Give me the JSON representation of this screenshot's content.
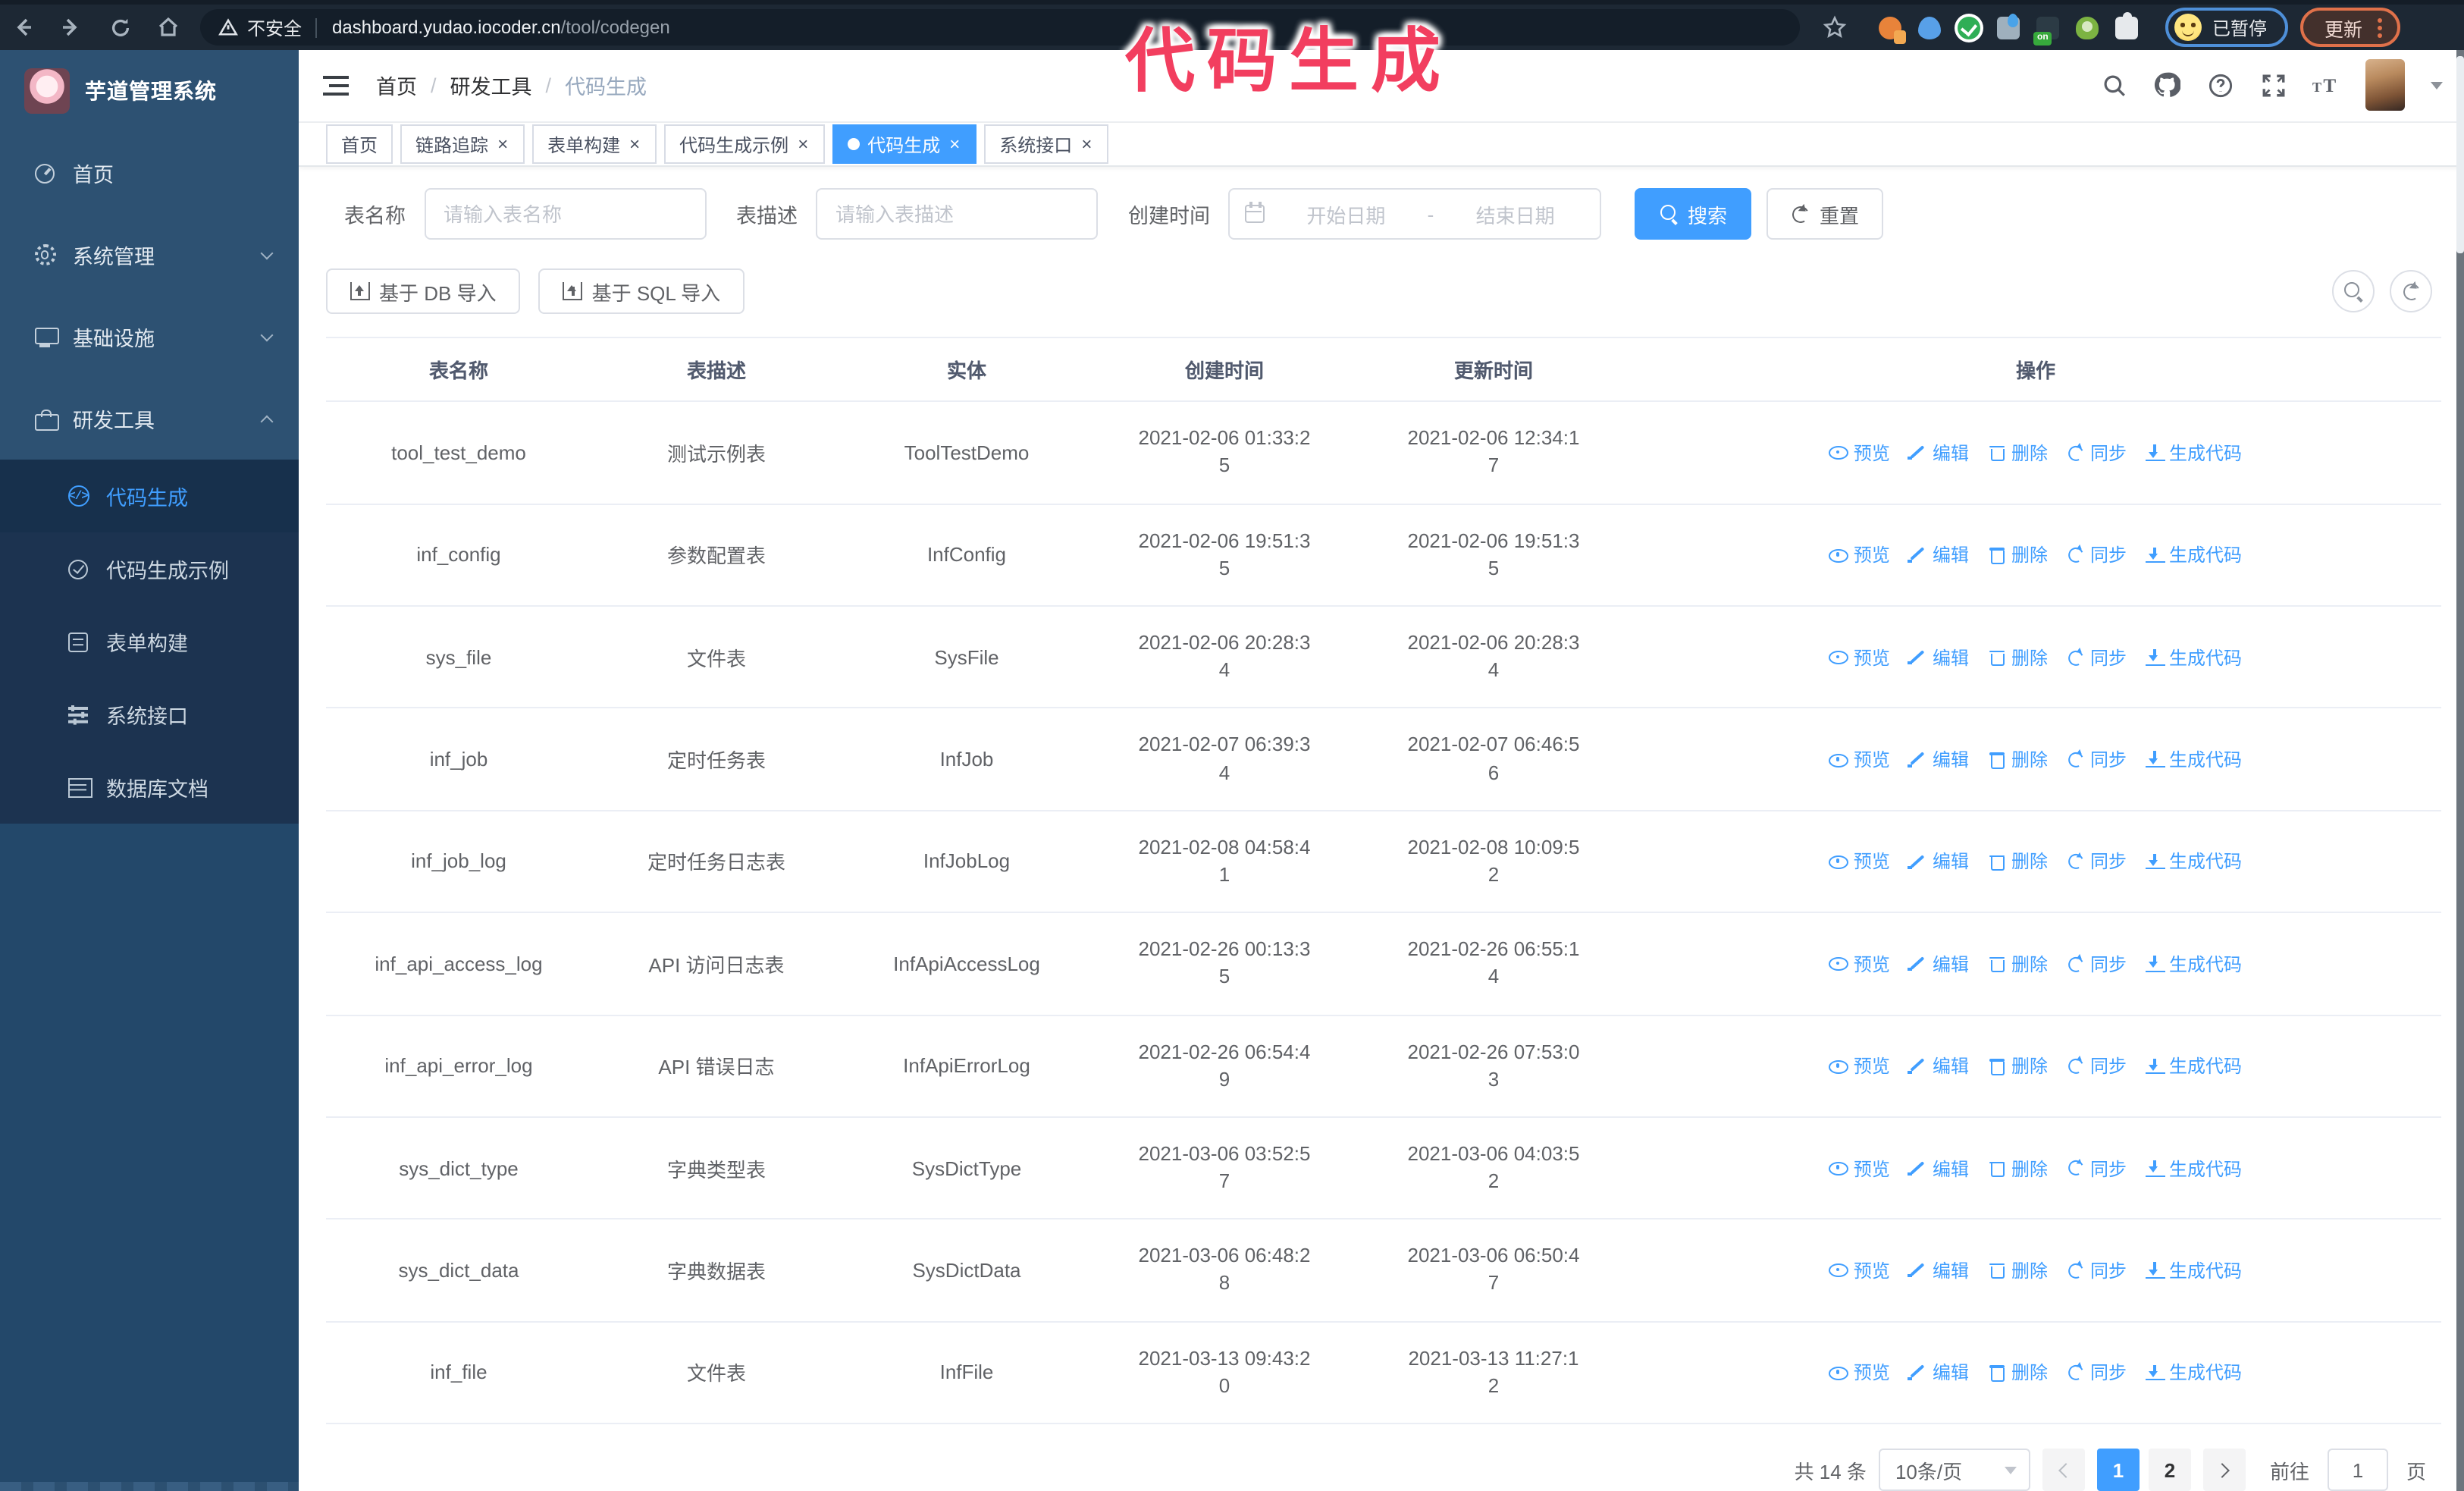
{
  "colors": {
    "primary": "#409EFF",
    "annotation": "#F23E5F",
    "sidebar_bg": "#23486A",
    "sidebar_menu_bg": "#2D5172",
    "sidebar_submenu_bg": "#1C3350",
    "chrome_bg": "#1D2834",
    "tag_active_bg": "#409EFF"
  },
  "browser": {
    "nav_icons": [
      "back-icon",
      "forward-icon",
      "reload-icon",
      "home-icon"
    ],
    "security_label": "不安全",
    "url_host": "dashboard.yudao.iocoder.cn",
    "url_path": "/tool/codegen",
    "extensions": [
      {
        "kind": "ext-orange",
        "name": "extension-icon-1"
      },
      {
        "kind": "ext-blue",
        "name": "extension-icon-2"
      },
      {
        "kind": "ext-green-check",
        "name": "extension-icon-3"
      },
      {
        "kind": "ext-grid",
        "name": "extension-icon-4"
      },
      {
        "kind": "ext-dark-on",
        "name": "extension-icon-5"
      },
      {
        "kind": "ext-green-figure",
        "name": "extension-icon-6"
      },
      {
        "kind": "ext-puzzle",
        "name": "extension-icon-7"
      }
    ],
    "profile_status": "已暂停",
    "update_label": "更新"
  },
  "annotation": {
    "text": "代码生成"
  },
  "sidebar": {
    "title": "芋道管理系统",
    "items": [
      {
        "label": "首页",
        "icon": "dashboard",
        "name": "sidebar-item-home"
      },
      {
        "label": "系统管理",
        "icon": "gear",
        "chevron": "down",
        "name": "sidebar-item-system-management"
      },
      {
        "label": "基础设施",
        "icon": "monitor",
        "chevron": "down",
        "name": "sidebar-item-infrastructure"
      },
      {
        "label": "研发工具",
        "icon": "toolbox",
        "chevron": "up",
        "expanded": true,
        "name": "sidebar-item-dev-tools"
      }
    ],
    "sub_items": [
      {
        "label": "代码生成",
        "icon": "code",
        "active": true,
        "name": "sidebar-subitem-code-generation"
      },
      {
        "label": "代码生成示例",
        "icon": "medal",
        "name": "sidebar-subitem-codegen-example"
      },
      {
        "label": "表单构建",
        "icon": "form",
        "name": "sidebar-subitem-form-builder"
      },
      {
        "label": "系统接口",
        "icon": "sliders",
        "name": "sidebar-subitem-system-api"
      },
      {
        "label": "数据库文档",
        "icon": "db",
        "name": "sidebar-subitem-database-doc"
      }
    ]
  },
  "header": {
    "breadcrumb": [
      "首页",
      "研发工具",
      "代码生成"
    ],
    "icons": [
      "search-icon",
      "github-icon",
      "help-icon",
      "fullscreen-icon",
      "font-size-icon"
    ]
  },
  "tabs": [
    {
      "label": "首页",
      "name": "tab-home"
    },
    {
      "label": "链路追踪",
      "closable": true,
      "name": "tab-link-tracing"
    },
    {
      "label": "表单构建",
      "closable": true,
      "name": "tab-form-builder"
    },
    {
      "label": "代码生成示例",
      "closable": true,
      "name": "tab-codegen-example"
    },
    {
      "label": "代码生成",
      "closable": true,
      "active": true,
      "name": "tab-code-generation"
    },
    {
      "label": "系统接口",
      "closable": true,
      "name": "tab-system-api"
    }
  ],
  "search": {
    "name_label": "表名称",
    "name_placeholder": "请输入表名称",
    "desc_label": "表描述",
    "desc_placeholder": "请输入表描述",
    "time_label": "创建时间",
    "start_placeholder": "开始日期",
    "range_separator": "-",
    "end_placeholder": "结束日期",
    "search_label": "搜索",
    "reset_label": "重置"
  },
  "toolbar": {
    "db_import_label": "基于 DB 导入",
    "sql_import_label": "基于 SQL 导入"
  },
  "table": {
    "columns": [
      {
        "label": "表名称"
      },
      {
        "label": "表描述"
      },
      {
        "label": "实体"
      },
      {
        "label": "创建时间"
      },
      {
        "label": "更新时间"
      },
      {
        "label": "操作"
      }
    ],
    "actions": [
      {
        "label": "预览",
        "icon": "eye",
        "name": "preview-link"
      },
      {
        "label": "编辑",
        "icon": "edit",
        "name": "edit-link"
      },
      {
        "label": "删除",
        "icon": "delete",
        "name": "delete-link"
      },
      {
        "label": "同步",
        "icon": "sync",
        "name": "sync-link"
      },
      {
        "label": "生成代码",
        "icon": "download",
        "name": "generate-code-link"
      }
    ],
    "rows": [
      {
        "name": "tool_test_demo",
        "desc": "测试示例表",
        "entity": "ToolTestDemo",
        "created": "2021-02-06 01:33:25",
        "updated": "2021-02-06 12:34:17"
      },
      {
        "name": "inf_config",
        "desc": "参数配置表",
        "entity": "InfConfig",
        "created": "2021-02-06 19:51:35",
        "updated": "2021-02-06 19:51:35"
      },
      {
        "name": "sys_file",
        "desc": "文件表",
        "entity": "SysFile",
        "created": "2021-02-06 20:28:34",
        "updated": "2021-02-06 20:28:34"
      },
      {
        "name": "inf_job",
        "desc": "定时任务表",
        "entity": "InfJob",
        "created": "2021-02-07 06:39:34",
        "updated": "2021-02-07 06:46:56"
      },
      {
        "name": "inf_job_log",
        "desc": "定时任务日志表",
        "entity": "InfJobLog",
        "created": "2021-02-08 04:58:41",
        "updated": "2021-02-08 10:09:52"
      },
      {
        "name": "inf_api_access_log",
        "desc": "API 访问日志表",
        "entity": "InfApiAccessLog",
        "created": "2021-02-26 00:13:35",
        "updated": "2021-02-26 06:55:14"
      },
      {
        "name": "inf_api_error_log",
        "desc": "API 错误日志",
        "entity": "InfApiErrorLog",
        "created": "2021-02-26 06:54:49",
        "updated": "2021-02-26 07:53:03"
      },
      {
        "name": "sys_dict_type",
        "desc": "字典类型表",
        "entity": "SysDictType",
        "created": "2021-03-06 03:52:57",
        "updated": "2021-03-06 04:03:52"
      },
      {
        "name": "sys_dict_data",
        "desc": "字典数据表",
        "entity": "SysDictData",
        "created": "2021-03-06 06:48:28",
        "updated": "2021-03-06 06:50:47"
      },
      {
        "name": "inf_file",
        "desc": "文件表",
        "entity": "InfFile",
        "created": "2021-03-13 09:43:20",
        "updated": "2021-03-13 11:27:12"
      }
    ]
  },
  "pagination": {
    "total_text": "共 14 条",
    "page_size": "10条/页",
    "pages": [
      {
        "label": "1",
        "active": true,
        "name": "page-1-button"
      },
      {
        "label": "2",
        "name": "page-2-button"
      }
    ],
    "goto_label": "前往",
    "goto_value": "1",
    "goto_unit": "页"
  }
}
